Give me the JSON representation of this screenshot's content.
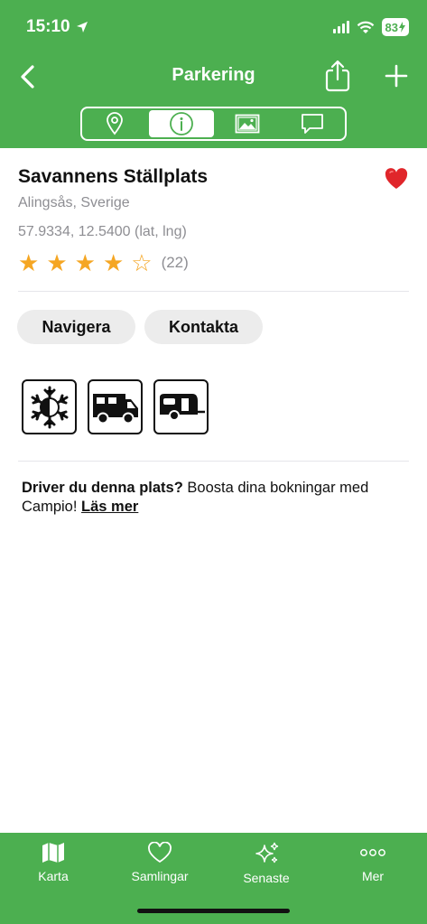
{
  "status_bar": {
    "time": "15:10",
    "battery": "83"
  },
  "nav": {
    "title": "Parkering"
  },
  "segments": [
    {
      "name": "map",
      "icon": "location-pin-icon"
    },
    {
      "name": "info",
      "icon": "info-icon",
      "active": true
    },
    {
      "name": "photos",
      "icon": "photo-icon"
    },
    {
      "name": "comments",
      "icon": "comment-icon"
    }
  ],
  "place": {
    "title": "Savannens Ställplats",
    "location": "Alingsås, Sverige",
    "coords": "57.9334, 12.5400 (lat, lng)",
    "rating": 4,
    "rating_max": 5,
    "rating_count": "(22)",
    "favorite": true
  },
  "actions": {
    "navigate": "Navigera",
    "contact": "Kontakta"
  },
  "facilities": [
    {
      "icon": "winter-open-icon"
    },
    {
      "icon": "motorhome-icon"
    },
    {
      "icon": "caravan-icon"
    }
  ],
  "promo": {
    "bold": "Driver du denna plats?",
    "text": " Boosta dina bokningar med Campio! ",
    "link": "Läs mer"
  },
  "tabs": [
    {
      "label": "Karta",
      "icon": "map-icon"
    },
    {
      "label": "Samlingar",
      "icon": "heart-icon"
    },
    {
      "label": "Senaste",
      "icon": "sparkles-icon"
    },
    {
      "label": "Mer",
      "icon": "more-icon"
    }
  ],
  "colors": {
    "brand": "#4caf50",
    "star": "#f5a623",
    "favorite": "#e0262b"
  }
}
